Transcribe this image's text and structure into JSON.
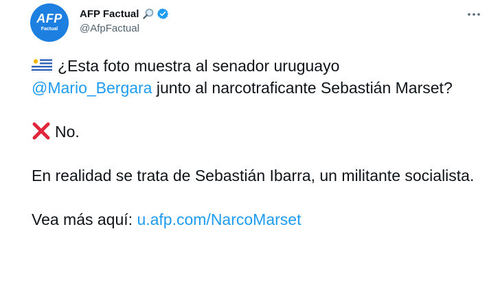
{
  "author": {
    "avatar_text": "AFP",
    "avatar_subtext": "Factual",
    "display_name": "AFP Factual",
    "handle": "@AfpFactual",
    "verified": true
  },
  "tweet": {
    "line1_text": "¿Esta foto muestra al senador uruguayo",
    "mention": "@Mario_Bergara",
    "line2_text": " junto al narcotraficante Sebastián Marset?",
    "answer_text": "No.",
    "explanation": "En realidad se trata de Sebastián Ibarra, un militante socialista.",
    "more_prefix": "Vea más aquí: ",
    "more_link": "u.afp.com/NarcoMarset"
  },
  "icons": {
    "flag": "uruguay-flag-icon",
    "answer": "red-x-icon",
    "search": "magnifying-glass-icon",
    "verified": "verified-badge-icon",
    "more": "more-options-icon"
  },
  "colors": {
    "avatar_bg": "#1d7fe0",
    "link": "#1d9bf0",
    "verified": "#1d9bf0",
    "x_mark": "#e0263a",
    "handle": "#536471"
  }
}
